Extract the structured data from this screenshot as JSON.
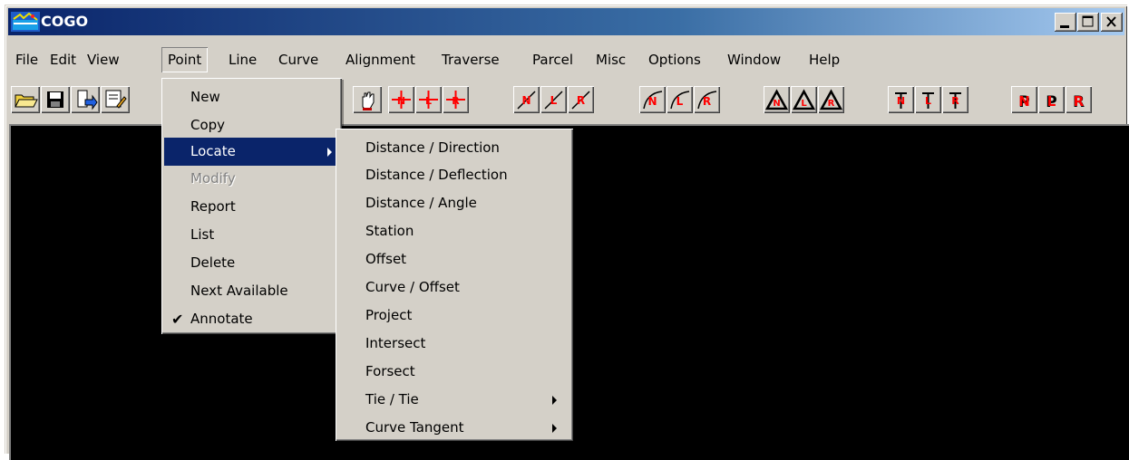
{
  "window": {
    "title": "COGO"
  },
  "title_buttons": [
    "minimize-icon",
    "maximize-icon",
    "close-icon"
  ],
  "menubar": [
    {
      "label": "File"
    },
    {
      "label": "Edit"
    },
    {
      "label": "View"
    },
    {
      "label": "Point"
    },
    {
      "label": "Line"
    },
    {
      "label": "Curve"
    },
    {
      "label": "Alignment"
    },
    {
      "label": "Traverse"
    },
    {
      "label": "Parcel"
    },
    {
      "label": "Misc"
    },
    {
      "label": "Options"
    },
    {
      "label": "Window"
    },
    {
      "label": "Help"
    }
  ],
  "open_menu": "Point",
  "toolbar_icons": [
    "open-folder-icon",
    "save-icon",
    "import-icon",
    "edit-document-icon",
    "pan-hand-icon",
    "point-n-icon",
    "point-l-icon",
    "point-r-icon",
    "line-n-icon",
    "line-l-icon",
    "line-r-icon",
    "curve-n-icon",
    "curve-l-icon",
    "curve-r-icon",
    "triangle-n-icon",
    "triangle-l-icon",
    "triangle-r-icon",
    "traverse-n-icon",
    "traverse-l-icon",
    "traverse-r-icon",
    "parcel-n-icon",
    "parcel-l-icon",
    "parcel-r-icon"
  ],
  "point_menu": {
    "items": [
      {
        "label": "New"
      },
      {
        "label": "Copy"
      },
      {
        "label": "Locate"
      },
      {
        "label": "Modify"
      },
      {
        "label": "Report"
      },
      {
        "label": "List"
      },
      {
        "label": "Delete"
      },
      {
        "label": "Next Available"
      },
      {
        "label": "Annotate"
      }
    ],
    "selected": "Locate",
    "disabled": [
      "Modify"
    ],
    "checked": [
      "Annotate"
    ],
    "submenu_parent": [
      "Locate"
    ]
  },
  "locate_submenu": {
    "items": [
      {
        "label": "Distance / Direction"
      },
      {
        "label": "Distance / Deflection"
      },
      {
        "label": "Distance / Angle"
      },
      {
        "label": "Station"
      },
      {
        "label": "Offset"
      },
      {
        "label": "Curve / Offset"
      },
      {
        "label": "Project"
      },
      {
        "label": "Intersect"
      },
      {
        "label": "Forsect"
      },
      {
        "label": "Tie / Tie"
      },
      {
        "label": "Curve Tangent"
      }
    ],
    "has_submenu": [
      "Tie / Tie",
      "Curve Tangent"
    ]
  },
  "colors": {
    "title_gradient_start": "#0a246a",
    "title_gradient_end": "#a6caf0",
    "face": "#d4d0c8",
    "selection": "#0a246a",
    "canvas": "#000000",
    "icon_accent": "#ff0000"
  }
}
